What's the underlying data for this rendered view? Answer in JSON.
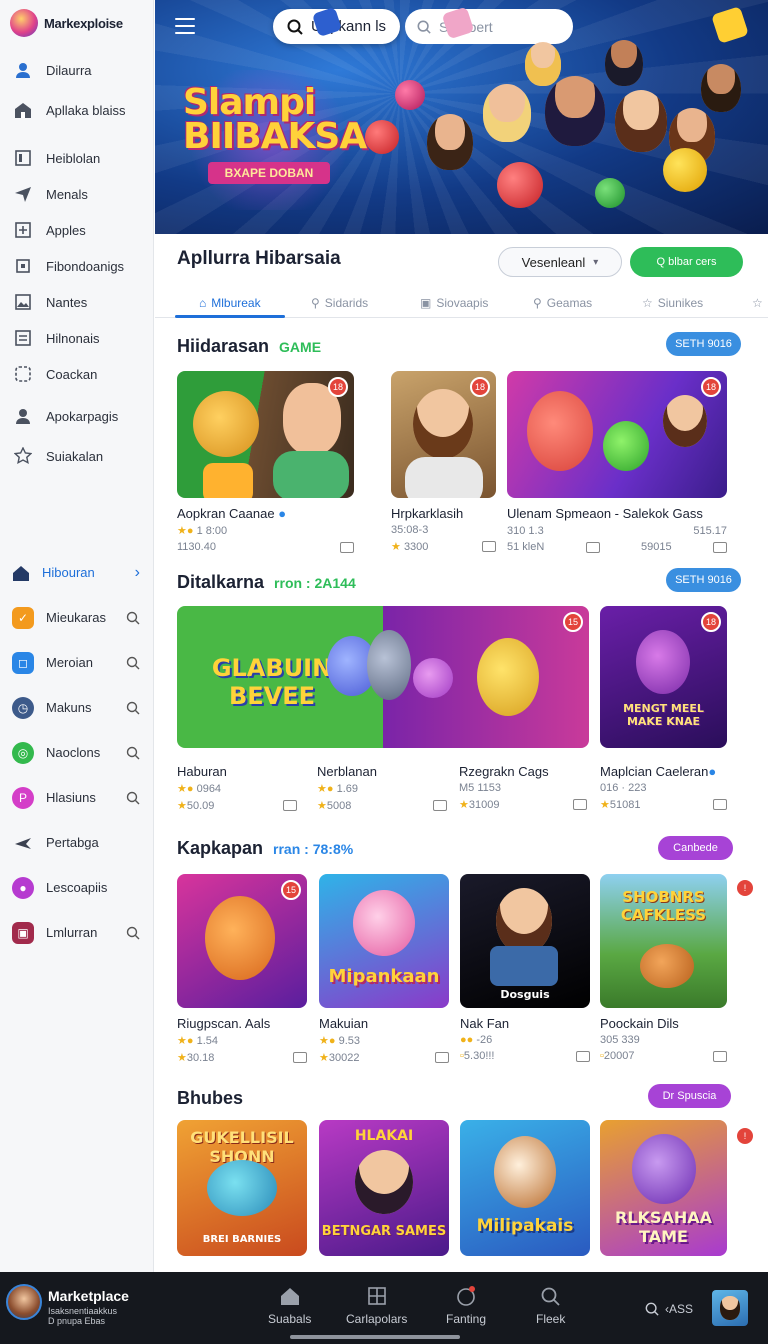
{
  "brand": {
    "name": "Markexploise"
  },
  "sidebar": {
    "top_items": [
      {
        "label": "Dilaurra",
        "icon": "user-icon"
      },
      {
        "label": "Apllaka blaiss",
        "icon": "store-icon"
      },
      {
        "label": "Heiblolan",
        "icon": "box-icon"
      },
      {
        "label": "Menals",
        "icon": "send-icon"
      },
      {
        "label": "Apples",
        "icon": "puzzle-icon"
      },
      {
        "label": "Fibondoanigs",
        "icon": "square-icon"
      },
      {
        "label": "Nantes",
        "icon": "image-icon"
      },
      {
        "label": "Hilnonais",
        "icon": "list-icon"
      },
      {
        "label": "Coackan",
        "icon": "dice-icon"
      },
      {
        "label": "Apokarpagis",
        "icon": "user-icon"
      },
      {
        "label": "Suiakalan",
        "icon": "star-icon"
      }
    ],
    "sec_items": [
      {
        "label": "Hibouran",
        "icon": "home-icon",
        "active": true
      },
      {
        "label": "Mieukaras",
        "icon": "orange-app-icon",
        "color": "#f39a1e"
      },
      {
        "label": "Meroian",
        "icon": "blue-app-icon",
        "color": "#2a86e6"
      },
      {
        "label": "Makuns",
        "icon": "clock-icon",
        "color": "#3d5a8a"
      },
      {
        "label": "Naoclons",
        "icon": "green-app-icon",
        "color": "#33b94d"
      },
      {
        "label": "Hlasiuns",
        "icon": "pink-app-icon",
        "color": "#d43ec8"
      },
      {
        "label": "Pertabga",
        "icon": "plane-icon"
      },
      {
        "label": "Lescoapiis",
        "icon": "purple-app-icon",
        "color": "#b63bd0"
      },
      {
        "label": "Lmlurran",
        "icon": "red-app-icon",
        "color": "#a12a4c"
      }
    ]
  },
  "hero": {
    "search_label": "Uapkann ls",
    "search_placeholder": "Seruoert",
    "title": "Slampi BIIBAKSA",
    "ribbon": "BXAPE DOBAN"
  },
  "main": {
    "title": "Apllurra Hibarsaia",
    "select_value": "Vesenleanl",
    "action_label": "Q blbar cers",
    "tabs": [
      {
        "label": "Mlbureak",
        "icon": "⌂"
      },
      {
        "label": "Sidarids",
        "icon": "⚲"
      },
      {
        "label": "Siovaapis",
        "icon": "▣"
      },
      {
        "label": "Geamas",
        "icon": "⚲"
      },
      {
        "label": "Siunikes",
        "icon": "☆"
      }
    ]
  },
  "sections": [
    {
      "title": "Hiidarasan",
      "sub": "GAME",
      "pill": "SETH 9016",
      "pill_color": "#3a8fe0",
      "cards": [
        {
          "name": "Aopkran Caanae",
          "meta1": "1 8:00",
          "meta2": "1130.40",
          "badge": "18"
        },
        {
          "name": "Hrpkarklasih",
          "meta1": "35:08-3",
          "meta2": "3300",
          "badge": "18"
        },
        {
          "name": "Ulenam Spmeaon - Salekok Gass",
          "meta1": "310 1.3",
          "meta1b": "515.17",
          "meta2": "51 kleN",
          "meta2b": "59015",
          "badge": "18"
        }
      ]
    },
    {
      "title": "Ditalkarna",
      "sub": "rron : 2A144",
      "pill": "SETH 9016",
      "pill_color": "#3a8fe0",
      "cards": [
        {
          "name": "Haburan",
          "meta1": "0964",
          "meta2": "50.09",
          "thumb_text": "GLABUIN BEVEE",
          "badge": ""
        },
        {
          "name": "Nerblanan",
          "meta1": "1.69",
          "meta2": "5008",
          "badge": ""
        },
        {
          "name": "Rzegrakn Cags",
          "meta1": "M5 1153",
          "meta2": "31009",
          "badge": "15"
        },
        {
          "name": "Maplcian Caeleran",
          "meta1": "016 · 223",
          "meta2": "51081",
          "thumb_text": "MENGT MEEL MAKE KNAE",
          "badge": "18"
        }
      ]
    },
    {
      "title": "Kapkapan",
      "sub": "rran : 78:8%",
      "pill": "Canbede",
      "pill_color": "#a743d6",
      "cards": [
        {
          "name": "Riugpscan. Aals",
          "meta1": "1.54",
          "meta2": "30.18",
          "badge": "15"
        },
        {
          "name": "Makuian",
          "meta1": "9.53",
          "meta2": "30022",
          "thumb_text": "Mipankaan",
          "badge": ""
        },
        {
          "name": "Nak Fan",
          "meta1": "-26",
          "meta2": "5.30!!!",
          "thumb_text": "Dosguis",
          "badge": ""
        },
        {
          "name": "Poockain Dils",
          "meta1": "305 339",
          "meta2": "20007",
          "thumb_text": "SHOBNRS CAFKLESS",
          "badge": ""
        }
      ]
    },
    {
      "title": "Bhubes",
      "sub": "",
      "pill": "Dr Spuscia",
      "pill_color": "#a743d6",
      "cards": [
        {
          "name": "",
          "thumb_text": "GUKELLISIL SHONN",
          "thumb_text2": "BREI BARNIES",
          "badge": ""
        },
        {
          "name": "",
          "thumb_text": "HLAKAI",
          "thumb_text2": "BETNGAR SAMES",
          "badge": ""
        },
        {
          "name": "",
          "thumb_text": "Milipakais",
          "badge": ""
        },
        {
          "name": "",
          "thumb_text": "RLKSAHAA TAME",
          "badge": ""
        }
      ]
    }
  ],
  "bottombar": {
    "title": "Marketplace",
    "sub1": "Isaksnentiaakkus",
    "sub2": "D pnupa Ebas",
    "nav": [
      "Suabals",
      "Carlapolars",
      "Fanting",
      "Fleek"
    ],
    "right_label": "‹ASS"
  }
}
